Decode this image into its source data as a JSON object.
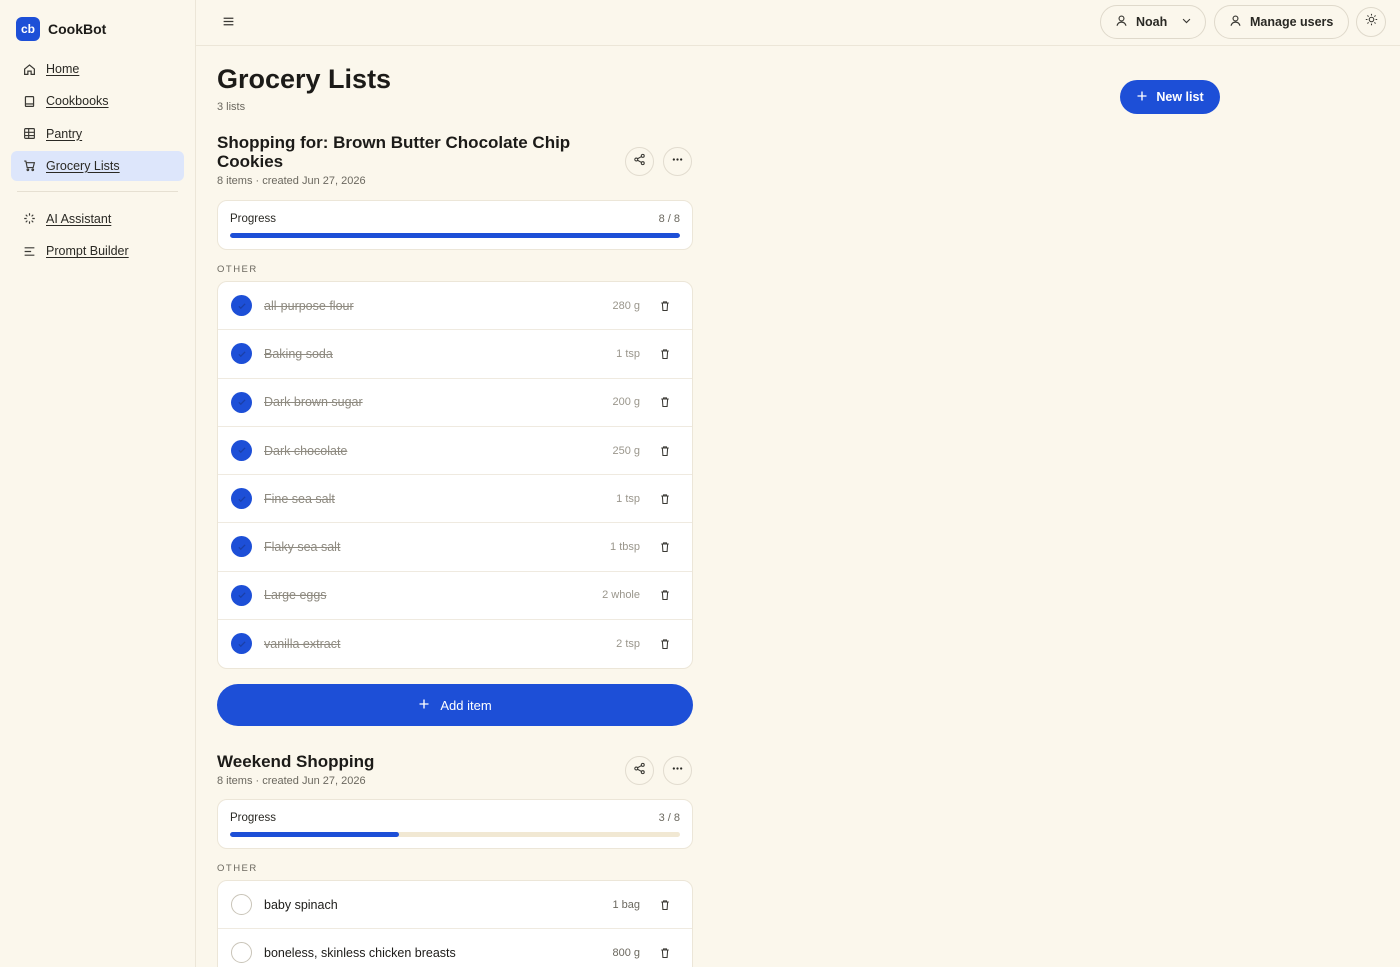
{
  "app": {
    "logo_text": "cb",
    "name": "CookBot"
  },
  "sidebar": {
    "items": [
      {
        "label": "Home",
        "icon": "home-icon"
      },
      {
        "label": "Cookbooks",
        "icon": "book-icon"
      },
      {
        "label": "Pantry",
        "icon": "grid-icon"
      },
      {
        "label": "Grocery Lists",
        "icon": "cart-icon",
        "active": true
      },
      {
        "label": "AI Assistant",
        "icon": "sparkle-icon"
      },
      {
        "label": "Prompt Builder",
        "icon": "lines-icon"
      }
    ]
  },
  "header": {
    "user_name": "Noah",
    "manage_users_label": "Manage users"
  },
  "page": {
    "title": "Grocery Lists",
    "subtitle": "3 lists",
    "new_list_label": "New list"
  },
  "lists": [
    {
      "title": "Shopping for: Brown Butter Chocolate Chip Cookies",
      "meta": "8 items · created Jun 27, 2026",
      "progress_label": "Progress",
      "progress_text": "8 / 8",
      "progress_fraction": 1.0,
      "group_label": "OTHER",
      "items": [
        {
          "name": "all-purpose flour",
          "qty": "280 g",
          "done": true
        },
        {
          "name": "Baking soda",
          "qty": "1 tsp",
          "done": true
        },
        {
          "name": "Dark brown sugar",
          "qty": "200 g",
          "done": true
        },
        {
          "name": "Dark chocolate",
          "qty": "250 g",
          "done": true
        },
        {
          "name": "Fine sea salt",
          "qty": "1 tsp",
          "done": true
        },
        {
          "name": "Flaky sea salt",
          "qty": "1 tbsp",
          "done": true
        },
        {
          "name": "Large eggs",
          "qty": "2 whole",
          "done": true
        },
        {
          "name": "vanilla extract",
          "qty": "2 tsp",
          "done": true
        }
      ],
      "add_item_label": "Add item"
    },
    {
      "title": "Weekend Shopping",
      "meta": "8 items · created Jun 27, 2026",
      "progress_label": "Progress",
      "progress_text": "3 / 8",
      "progress_fraction": 0.375,
      "group_label": "OTHER",
      "items": [
        {
          "name": "baby spinach",
          "qty": "1 bag",
          "done": false
        },
        {
          "name": "boneless, skinless chicken breasts",
          "qty": "800 g",
          "done": false
        }
      ]
    }
  ],
  "colors": {
    "accent": "#1d4fd7",
    "background": "#fbf7ec",
    "active_nav": "#dde6fb"
  }
}
